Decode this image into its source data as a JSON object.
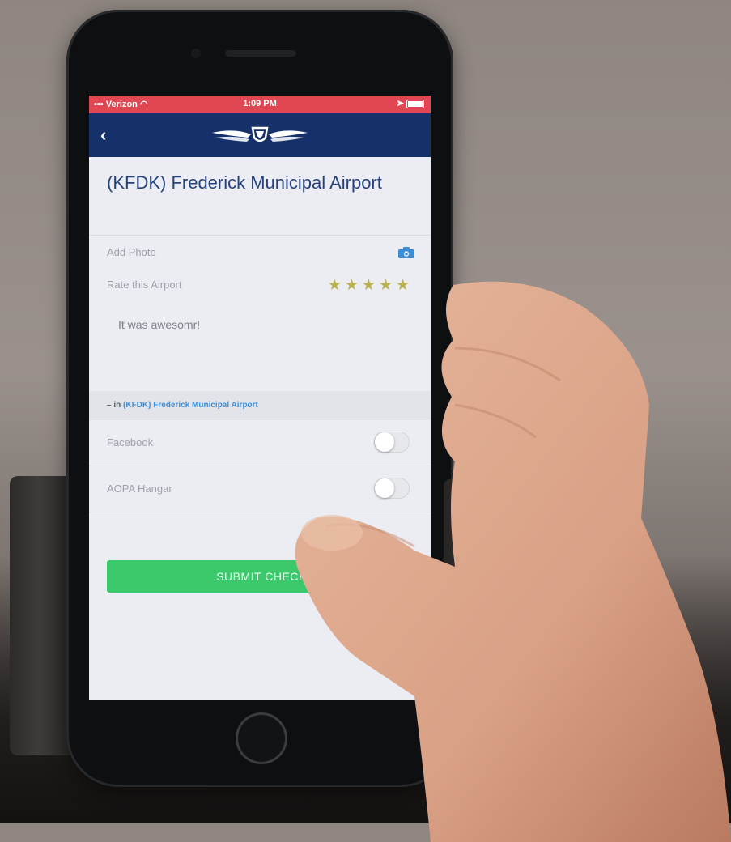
{
  "status_bar": {
    "carrier": "Verizon",
    "time": "1:09 PM"
  },
  "nav": {
    "back_icon": "chevron-left-icon",
    "logo_icon": "aopa-wings-logo"
  },
  "airport": {
    "title": "(KFDK) Frederick Municipal Airport"
  },
  "form": {
    "add_photo_label": "Add Photo",
    "camera_icon": "camera-icon",
    "rate_label": "Rate this Airport",
    "rating": 5,
    "rating_max": 5,
    "comment": "It was awesomr!",
    "location_prefix": "– in",
    "location_link": "(KFDK) Frederick Municipal Airport",
    "share_options": [
      {
        "label": "Facebook",
        "enabled": false
      },
      {
        "label": "AOPA Hangar",
        "enabled": false
      }
    ],
    "submit_label": "SUBMIT CHECK"
  },
  "colors": {
    "status_bar": "#e04752",
    "nav_bar": "#16306a",
    "title": "#26427d",
    "star": "#b9b04e",
    "submit": "#3cc96c",
    "link": "#3e8fd6"
  }
}
